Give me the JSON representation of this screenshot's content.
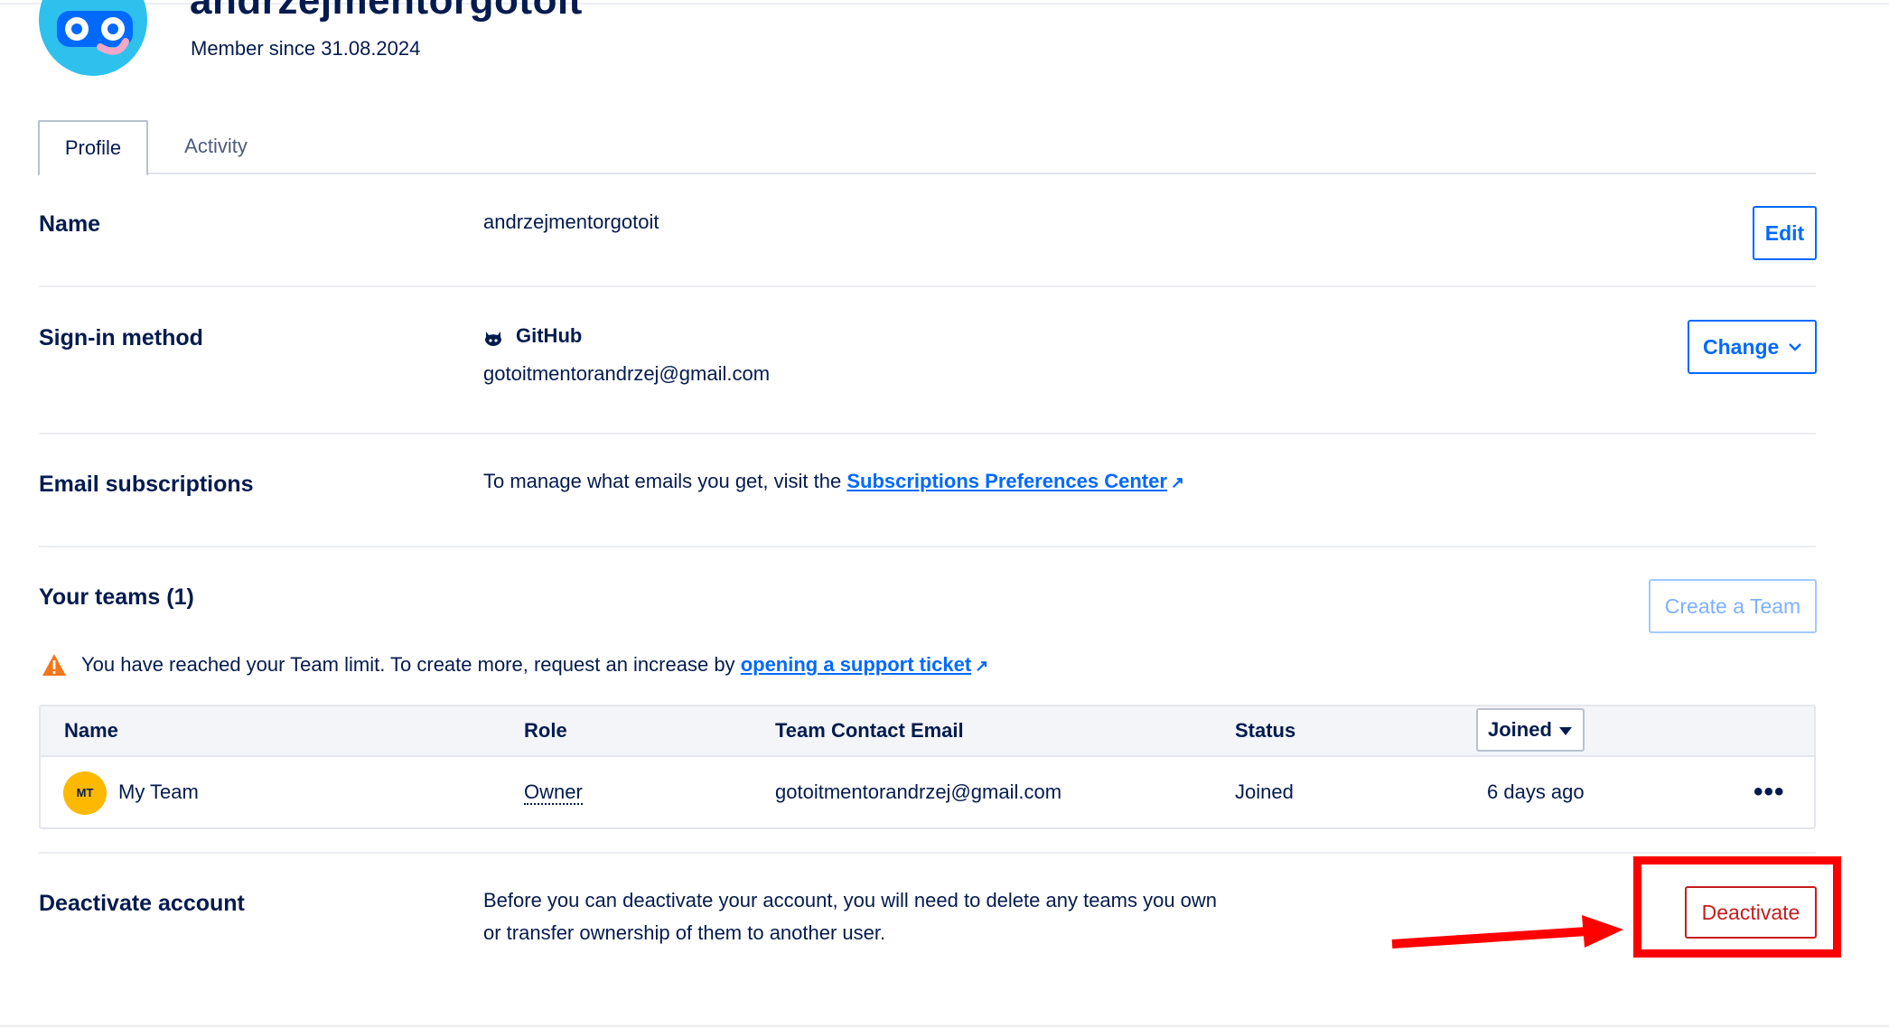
{
  "header": {
    "username": "andrzejmentorgotoit",
    "member_since": "Member since 31.08.2024"
  },
  "tabs": [
    {
      "label": "Profile",
      "active": true
    },
    {
      "label": "Activity",
      "active": false
    }
  ],
  "name_section": {
    "label": "Name",
    "value": "andrzejmentorgotoit",
    "button": "Edit"
  },
  "signin_section": {
    "label": "Sign-in method",
    "provider": "GitHub",
    "email": "gotoitmentorandrzej@gmail.com",
    "button": "Change"
  },
  "email_section": {
    "label": "Email subscriptions",
    "text": "To manage what emails you get, visit the",
    "link": "Subscriptions Preferences Center"
  },
  "teams_section": {
    "label": "Your teams (1)",
    "button": "Create a Team",
    "warning_text": "You have reached your Team limit. To create more, request an increase by",
    "warning_link": "opening a support ticket",
    "columns": [
      "Name",
      "Role",
      "Team Contact Email",
      "Status",
      "Joined"
    ],
    "rows": [
      {
        "initials": "MT",
        "name": "My Team",
        "role": "Owner",
        "email": "gotoitmentorandrzej@gmail.com",
        "status": "Joined",
        "joined": "6 days ago"
      }
    ]
  },
  "deactivate_section": {
    "label": "Deactivate account",
    "text_line1": "Before you can deactivate your account, you will need to delete any teams you own",
    "text_line2": "or transfer ownership of them to another user.",
    "button": "Deactivate"
  },
  "colors": {
    "primary": "#0069ff",
    "danger": "#c61d1d",
    "annotation": "#ff0000",
    "text": "#031b4e"
  }
}
